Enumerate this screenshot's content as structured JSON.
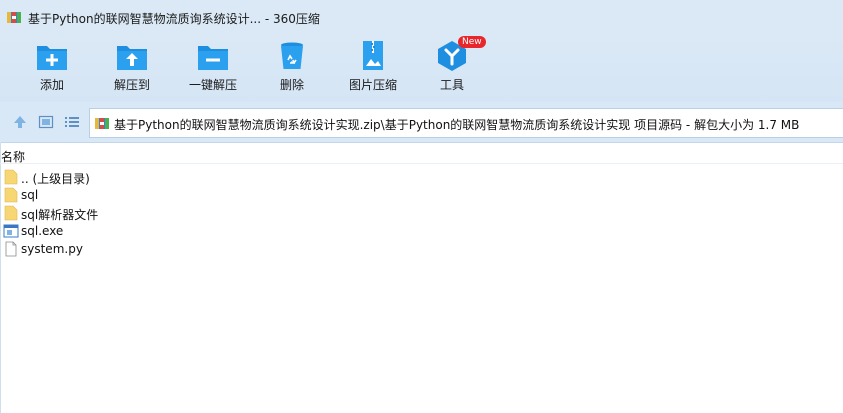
{
  "window": {
    "title": "基于Python的联网智慧物流质询系统设计... - 360压缩"
  },
  "toolbar": {
    "add_label": "添加",
    "extract_to_label": "解压到",
    "one_click_extract_label": "一键解压",
    "delete_label": "删除",
    "image_compress_label": "图片压缩",
    "tools_label": "工具",
    "tools_badge": "New"
  },
  "address": {
    "path": "基于Python的联网智慧物流质询系统设计实现.zip\\基于Python的联网智慧物流质询系统设计实现 项目源码 - 解包大小为 1.7 MB"
  },
  "columns": {
    "name": "名称"
  },
  "files": [
    {
      "name": ".. (上级目录)",
      "icon": "folder-icon"
    },
    {
      "name": "sql",
      "icon": "folder-icon"
    },
    {
      "name": "sql解析器文件",
      "icon": "folder-icon"
    },
    {
      "name": "sql.exe",
      "icon": "exe-icon"
    },
    {
      "name": "system.py",
      "icon": "file-icon"
    }
  ],
  "colors": {
    "accent": "#1e8fe0",
    "toolbar_bg": "#dbe9f6",
    "badge": "#e8262b"
  }
}
